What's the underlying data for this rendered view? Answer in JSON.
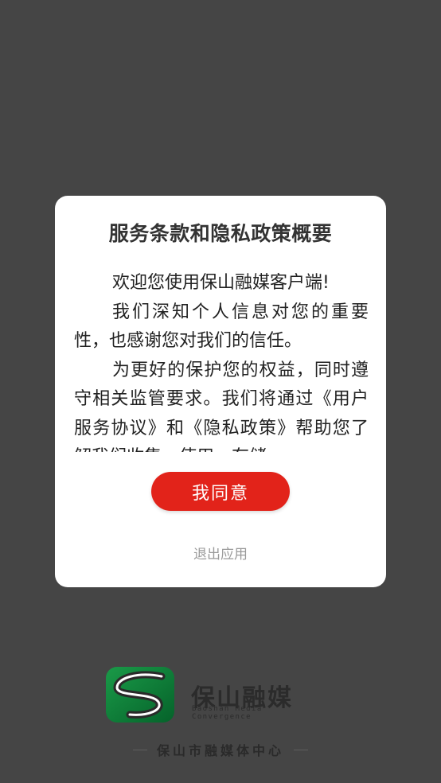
{
  "dialog": {
    "title": "服务条款和隐私政策概要",
    "paragraphs": [
      "欢迎您使用保山融媒客户端!",
      "我们深知个人信息对您的重要性，也感谢您对我们的信任。",
      "为更好的保护您的权益，同时遵守相关监管要求。我们将通过《用户服务协议》和《隐私政策》帮助您了解我们收集、使用、存储"
    ],
    "agree_label": "我同意",
    "exit_label": "退出应用"
  },
  "brand": {
    "name": "保山融媒",
    "subtitle": "Baoshan Media Convergence",
    "center_name": "保山市融媒体中心",
    "logo_color": "#0c8a3a"
  },
  "colors": {
    "overlay": "#454545",
    "accent": "#e2231a"
  }
}
